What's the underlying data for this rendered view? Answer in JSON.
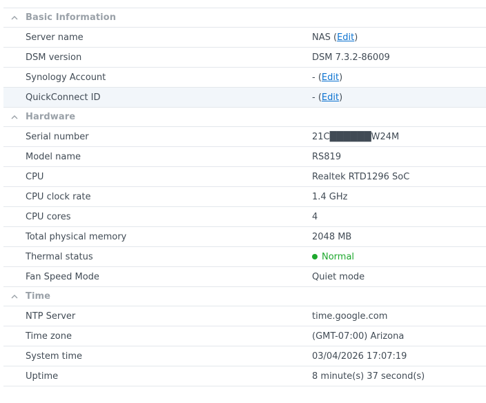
{
  "sections": {
    "basic": {
      "title": "Basic Information",
      "rows": {
        "server_name": {
          "label": "Server name",
          "value_prefix": "NAS (",
          "link": "Edit",
          "value_suffix": ")"
        },
        "dsm_version": {
          "label": "DSM version",
          "value": "DSM 7.3.2-86009"
        },
        "synology_account": {
          "label": "Synology Account",
          "value_prefix": "- (",
          "link": "Edit",
          "value_suffix": ")"
        },
        "quickconnect_id": {
          "label": "QuickConnect ID",
          "value_prefix": "- (",
          "link": "Edit",
          "value_suffix": ")"
        }
      }
    },
    "hardware": {
      "title": "Hardware",
      "rows": {
        "serial_number": {
          "label": "Serial number",
          "value": "21C██████W24M"
        },
        "model_name": {
          "label": "Model name",
          "value": "RS819"
        },
        "cpu": {
          "label": "CPU",
          "value": "Realtek RTD1296 SoC"
        },
        "cpu_clock_rate": {
          "label": "CPU clock rate",
          "value": "1.4 GHz"
        },
        "cpu_cores": {
          "label": "CPU cores",
          "value": "4"
        },
        "total_physical_memory": {
          "label": "Total physical memory",
          "value": "2048 MB"
        },
        "thermal_status": {
          "label": "Thermal status",
          "value": "Normal",
          "status_color": "#1ea82e"
        },
        "fan_speed_mode": {
          "label": "Fan Speed Mode",
          "value": "Quiet mode"
        }
      }
    },
    "time": {
      "title": "Time",
      "rows": {
        "ntp_server": {
          "label": "NTP Server",
          "value": "time.google.com"
        },
        "time_zone": {
          "label": "Time zone",
          "value": "(GMT-07:00) Arizona"
        },
        "system_time": {
          "label": "System time",
          "value": "03/04/2026 17:07:19"
        },
        "uptime": {
          "label": "Uptime",
          "value": "8 minute(s) 37 second(s)"
        }
      }
    }
  },
  "colors": {
    "link": "#0b72d0",
    "status_normal": "#1ea82e",
    "section_header": "#9aa1a8",
    "row_hover": "#f2f6fa"
  },
  "icons": {
    "section_toggle": "chevron-up-icon",
    "status": "status-dot-icon"
  }
}
